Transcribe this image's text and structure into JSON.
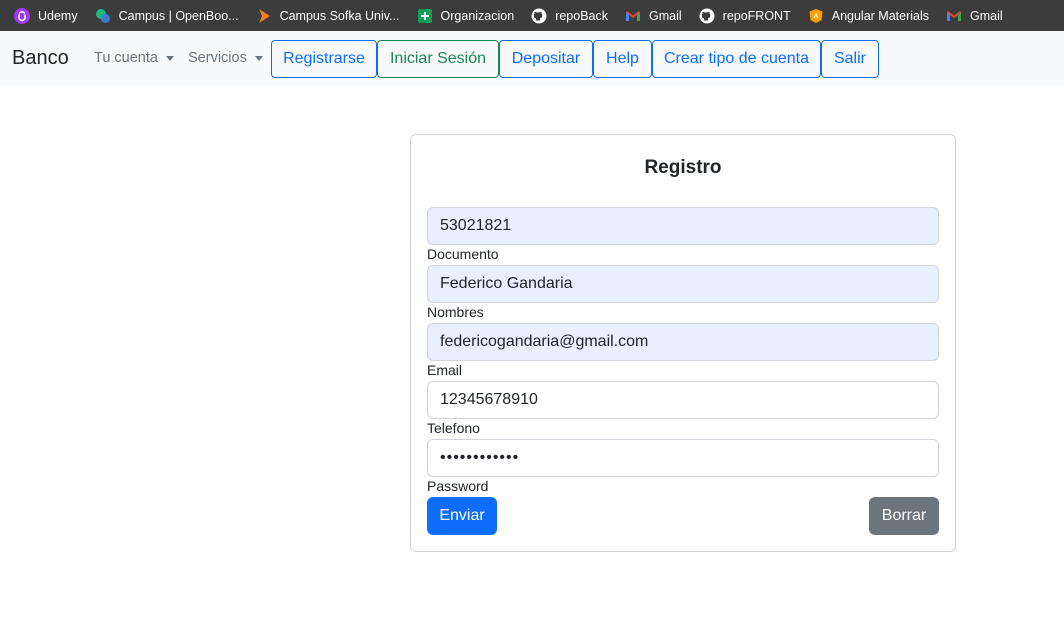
{
  "bookmarks": [
    {
      "label": "Udemy",
      "icon": "udemy-icon",
      "color": "#a435f0"
    },
    {
      "label": "Campus | OpenBoo...",
      "icon": "openbootcamp-icon",
      "color": "#1eb980"
    },
    {
      "label": "Campus Sofka Univ...",
      "icon": "sofka-icon",
      "color": "#f47b20"
    },
    {
      "label": "Organizacion",
      "icon": "sheets-icon",
      "color": "#0f9d58"
    },
    {
      "label": "repoBack",
      "icon": "github-icon",
      "color": "#ffffff"
    },
    {
      "label": "Gmail",
      "icon": "gmail-icon",
      "color": "#ea4335"
    },
    {
      "label": "repoFRONT",
      "icon": "github-icon",
      "color": "#ffffff"
    },
    {
      "label": "Angular Materials",
      "icon": "angular-material-icon",
      "color": "#ffa000"
    },
    {
      "label": "Gmail",
      "icon": "gmail-icon",
      "color": "#ea4335"
    }
  ],
  "navbar": {
    "brand": "Banco",
    "dropdowns": [
      "Tu cuenta",
      "Servicios"
    ],
    "buttons": [
      "Registrarse",
      "Iniciar Sesión",
      "Depositar",
      "Help",
      "Crear tipo de cuenta",
      "Salir"
    ]
  },
  "form": {
    "title": "Registro",
    "fields": [
      {
        "label": "Documento",
        "value": "53021821"
      },
      {
        "label": "Nombres",
        "value": "Federico Gandaria"
      },
      {
        "label": "Email",
        "value": "federicogandaria@gmail.com"
      },
      {
        "label": "Telefono",
        "value": "12345678910"
      },
      {
        "label": "Password",
        "value": "••••••••••••"
      }
    ],
    "submit": "Enviar",
    "clear": "Borrar"
  },
  "colors": {
    "primary": "#0d6efd",
    "success": "#198754",
    "secondary": "#6c757d",
    "autofill": "#e8f0fe"
  }
}
